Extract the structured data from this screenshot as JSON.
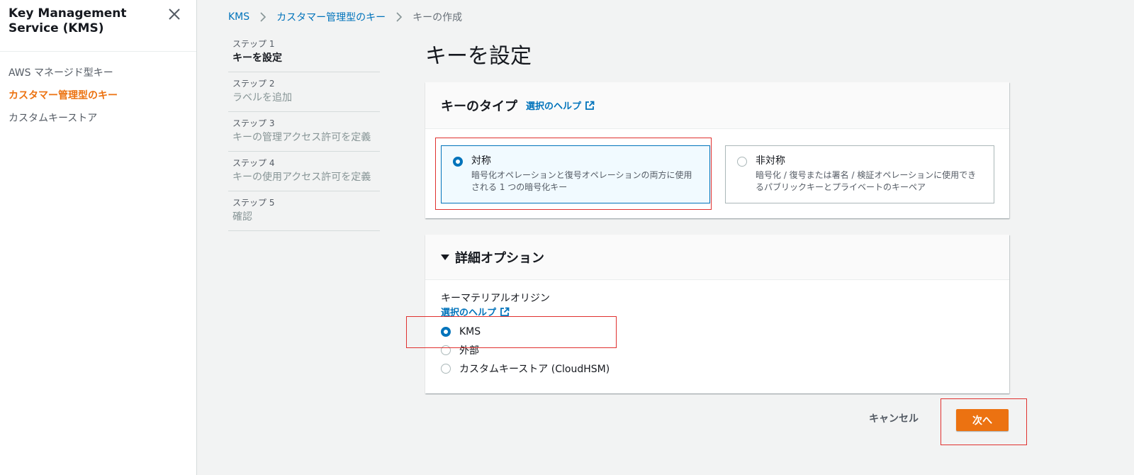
{
  "sidebar": {
    "title": "Key Management Service (KMS)",
    "close_icon": "close-icon",
    "items": [
      {
        "label": "AWS マネージド型キー",
        "active": false
      },
      {
        "label": "カスタマー管理型のキー",
        "active": true
      },
      {
        "label": "カスタムキーストア",
        "active": false
      }
    ]
  },
  "breadcrumb": {
    "items": [
      "KMS",
      "カスタマー管理型のキー"
    ],
    "current": "キーの作成",
    "separator_icon": "chevron-right-icon"
  },
  "steps": [
    {
      "num": "ステップ 1",
      "label": "キーを設定",
      "current": true
    },
    {
      "num": "ステップ 2",
      "label": "ラベルを追加",
      "current": false
    },
    {
      "num": "ステップ 3",
      "label": "キーの管理アクセス許可を定義",
      "current": false
    },
    {
      "num": "ステップ 4",
      "label": "キーの使用アクセス許可を定義",
      "current": false
    },
    {
      "num": "ステップ 5",
      "label": "確認",
      "current": false
    }
  ],
  "main": {
    "title": "キーを設定",
    "key_type": {
      "heading": "キーのタイプ",
      "help": "選択のヘルプ",
      "selected": "symmetric",
      "options": {
        "symmetric": {
          "title": "対称",
          "desc": "暗号化オペレーションと復号オペレーションの両方に使用される 1 つの暗号化キー"
        },
        "asymmetric": {
          "title": "非対称",
          "desc": "暗号化 / 復号または署名 / 検証オペレーションに使用できるパブリックキーとプライベートのキーペア"
        }
      }
    },
    "advanced": {
      "heading": "詳細オプション",
      "expanded": true,
      "origin_label": "キーマテリアルオリジン",
      "help": "選択のヘルプ",
      "selected": "KMS",
      "options": [
        "KMS",
        "外部",
        "カスタムキーストア (CloudHSM)"
      ]
    }
  },
  "footer": {
    "cancel": "キャンセル",
    "next": "次へ"
  },
  "colors": {
    "accent": "#ec7211",
    "link": "#0073bb",
    "highlight_box": "#e0312f"
  }
}
